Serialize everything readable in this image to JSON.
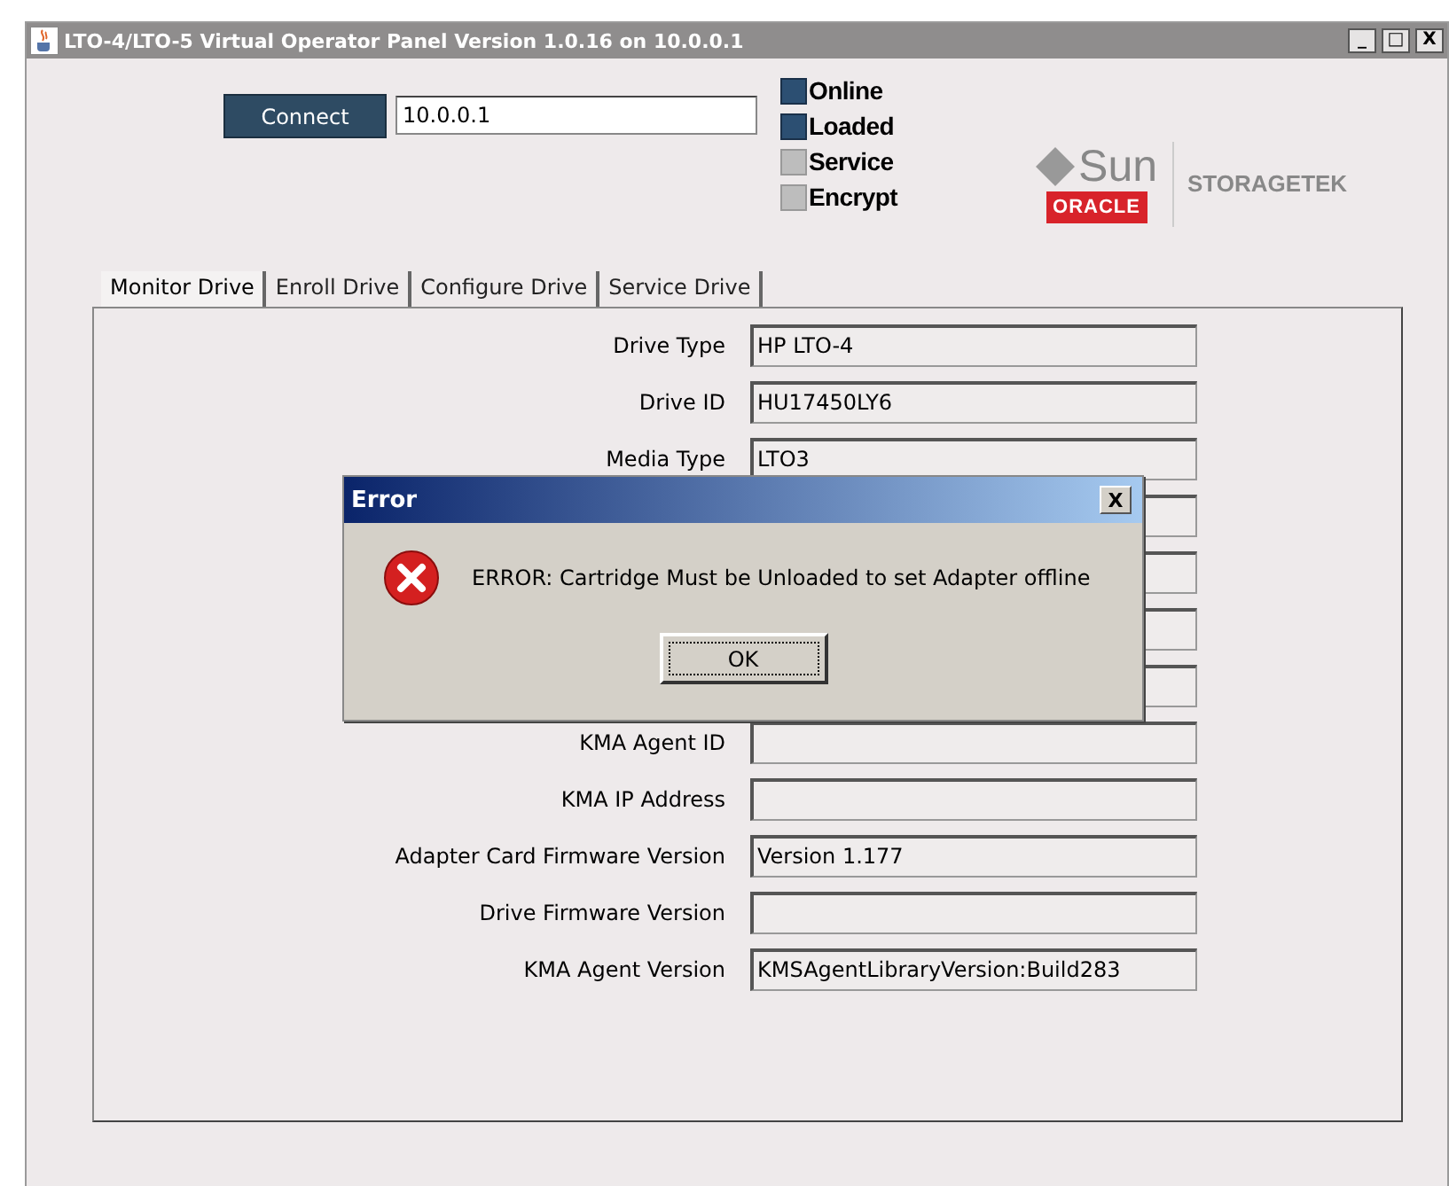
{
  "window": {
    "title": "LTO-4/LTO-5 Virtual Operator Panel Version 1.0.16 on 10.0.0.1",
    "controls": [
      "_",
      "□",
      "X"
    ]
  },
  "connect": {
    "button": "Connect",
    "address": "10.0.0.1"
  },
  "indicators": [
    {
      "label": "Online",
      "on": true
    },
    {
      "label": "Loaded",
      "on": true
    },
    {
      "label": "Service",
      "on": false
    },
    {
      "label": "Encrypt",
      "on": false
    }
  ],
  "logo": {
    "sun": "Sun",
    "oracle": "ORACLE",
    "storagetek": "STORAGETEK"
  },
  "tabs": [
    {
      "label": "Monitor Drive",
      "selected": true
    },
    {
      "label": "Enroll Drive",
      "selected": false
    },
    {
      "label": "Configure Drive",
      "selected": false
    },
    {
      "label": "Service Drive",
      "selected": false
    }
  ],
  "fields": [
    {
      "kind": "text",
      "label": "Drive Type",
      "value": "HP LTO-4"
    },
    {
      "kind": "text",
      "label": "Drive ID",
      "value": "HU17450LY6"
    },
    {
      "kind": "text",
      "label": "Media Type",
      "value": "LTO3"
    },
    {
      "kind": "covered"
    },
    {
      "kind": "covered"
    },
    {
      "kind": "covered"
    },
    {
      "kind": "covered"
    },
    {
      "kind": "text",
      "label": "KMA Agent ID"
    },
    {
      "kind": "text",
      "label": "KMA IP Address"
    },
    {
      "kind": "text",
      "label": "Adapter Card Firmware Version",
      "value": "Version 1.177"
    },
    {
      "kind": "text",
      "label": "Drive Firmware Version"
    },
    {
      "kind": "text",
      "label": "KMA Agent Version",
      "value": "KMSAgentLibraryVersion:Build283"
    }
  ],
  "dialog": {
    "title": "Error",
    "close": "X",
    "message": "ERROR: Cartridge Must be Unloaded to set Adapter offline",
    "button": "OK"
  }
}
